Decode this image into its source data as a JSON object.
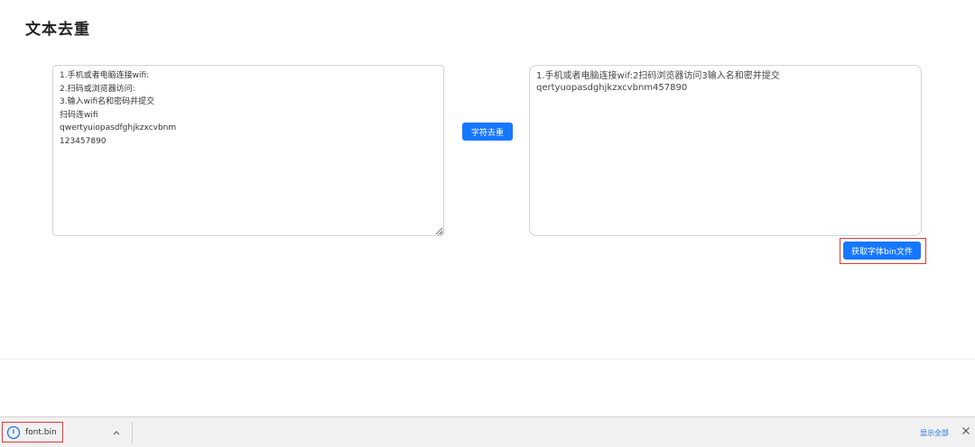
{
  "page": {
    "title": "文本去重"
  },
  "input": {
    "value": "1.手机或者电脑连接wifi:\n2.扫码或浏览器访问:\n3.输入wifi名和密码并提交\n扫码连wifi\nqwertyuiopasdfghjkzxcvbnm\n123457890"
  },
  "actions": {
    "dedupe_label": "字符去重",
    "get_font_bin_label": "获取字体bin文件"
  },
  "output": {
    "lines": [
      "1.手机或者电脑连接wif:2扫码浏览器访问3输入名和密并提交",
      "qertyuopasdghjkzxcvbnm457890"
    ]
  },
  "downloads": {
    "file_name": "font.bin",
    "show_all_label": "显示全部",
    "icons": {
      "item": "download-progress-icon",
      "menu": "chevron-up-icon",
      "close": "close-icon"
    }
  },
  "colors": {
    "primary": "#1677ff",
    "highlight": "#e53935",
    "link": "#1a73e8"
  }
}
